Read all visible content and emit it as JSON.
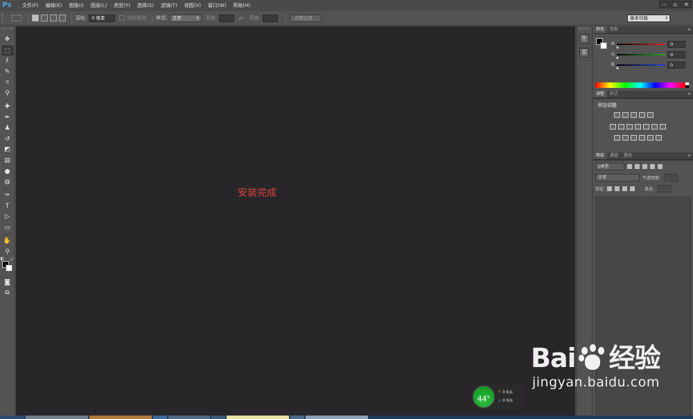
{
  "app": {
    "logo": "Ps"
  },
  "menu": [
    "文件(F)",
    "编辑(E)",
    "图像(I)",
    "图层(L)",
    "类型(Y)",
    "选择(S)",
    "滤镜(T)",
    "视图(V)",
    "窗口(W)",
    "帮助(H)"
  ],
  "window_controls": [
    "–",
    "▫",
    "✕"
  ],
  "options": {
    "feather_label": "羽化:",
    "feather_value": "0 像素",
    "antialias_label": "消除锯齿",
    "style_label": "样式:",
    "style_value": "正常",
    "width_label": "宽度:",
    "height_label": "高度:",
    "refine_edge": "调整边缘...",
    "workspace": "基本功能"
  },
  "canvas": {
    "message": "安装完成",
    "message_color": "#e04444",
    "background": "#282629"
  },
  "color_panel": {
    "tabs": [
      "颜色",
      "色板"
    ],
    "channels": [
      {
        "name": "R",
        "value": "0",
        "color": "#e02020"
      },
      {
        "name": "G",
        "value": "0",
        "color": "#20b020"
      },
      {
        "name": "B",
        "value": "0",
        "color": "#2040e0"
      }
    ]
  },
  "adjust_panel": {
    "tabs": [
      "调整",
      "样式"
    ],
    "title": "添加调整"
  },
  "layers_panel": {
    "tabs": [
      "图层",
      "通道",
      "路径"
    ],
    "filter": "ρ类型",
    "blend_mode": "正常",
    "opacity_label": "不透明度:",
    "lock_label": "锁定:",
    "fill_label": "填充:"
  },
  "network": {
    "percent": "44",
    "percent_unit": "%",
    "upload": "0 K/s",
    "download": "0 K/s"
  },
  "watermark": {
    "brand_left": "Bai",
    "brand_right": "经验",
    "subtitle": "jingyan.baidu.com"
  }
}
